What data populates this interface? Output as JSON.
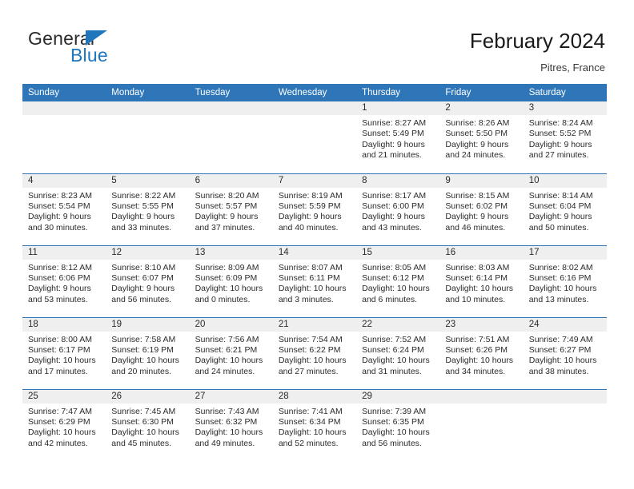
{
  "brand": {
    "name_part1": "General",
    "name_part2": "Blue",
    "triangle_icon": "triangle-icon",
    "accent_color": "#1F76BC"
  },
  "header": {
    "title": "February 2024",
    "location": "Pitres, France"
  },
  "calendar": {
    "header_color": "#2E76B8",
    "daynum_bg": "#EFEFEF",
    "weekday_headers": [
      "Sunday",
      "Monday",
      "Tuesday",
      "Wednesday",
      "Thursday",
      "Friday",
      "Saturday"
    ],
    "labels": {
      "sunrise": "Sunrise:",
      "sunset": "Sunset:",
      "daylight": "Daylight:"
    },
    "weeks": [
      [
        {
          "day": "",
          "lines": []
        },
        {
          "day": "",
          "lines": []
        },
        {
          "day": "",
          "lines": []
        },
        {
          "day": "",
          "lines": []
        },
        {
          "day": "1",
          "lines": [
            "Sunrise: 8:27 AM",
            "Sunset: 5:49 PM",
            "Daylight: 9 hours",
            "and 21 minutes."
          ]
        },
        {
          "day": "2",
          "lines": [
            "Sunrise: 8:26 AM",
            "Sunset: 5:50 PM",
            "Daylight: 9 hours",
            "and 24 minutes."
          ]
        },
        {
          "day": "3",
          "lines": [
            "Sunrise: 8:24 AM",
            "Sunset: 5:52 PM",
            "Daylight: 9 hours",
            "and 27 minutes."
          ]
        }
      ],
      [
        {
          "day": "4",
          "lines": [
            "Sunrise: 8:23 AM",
            "Sunset: 5:54 PM",
            "Daylight: 9 hours",
            "and 30 minutes."
          ]
        },
        {
          "day": "5",
          "lines": [
            "Sunrise: 8:22 AM",
            "Sunset: 5:55 PM",
            "Daylight: 9 hours",
            "and 33 minutes."
          ]
        },
        {
          "day": "6",
          "lines": [
            "Sunrise: 8:20 AM",
            "Sunset: 5:57 PM",
            "Daylight: 9 hours",
            "and 37 minutes."
          ]
        },
        {
          "day": "7",
          "lines": [
            "Sunrise: 8:19 AM",
            "Sunset: 5:59 PM",
            "Daylight: 9 hours",
            "and 40 minutes."
          ]
        },
        {
          "day": "8",
          "lines": [
            "Sunrise: 8:17 AM",
            "Sunset: 6:00 PM",
            "Daylight: 9 hours",
            "and 43 minutes."
          ]
        },
        {
          "day": "9",
          "lines": [
            "Sunrise: 8:15 AM",
            "Sunset: 6:02 PM",
            "Daylight: 9 hours",
            "and 46 minutes."
          ]
        },
        {
          "day": "10",
          "lines": [
            "Sunrise: 8:14 AM",
            "Sunset: 6:04 PM",
            "Daylight: 9 hours",
            "and 50 minutes."
          ]
        }
      ],
      [
        {
          "day": "11",
          "lines": [
            "Sunrise: 8:12 AM",
            "Sunset: 6:06 PM",
            "Daylight: 9 hours",
            "and 53 minutes."
          ]
        },
        {
          "day": "12",
          "lines": [
            "Sunrise: 8:10 AM",
            "Sunset: 6:07 PM",
            "Daylight: 9 hours",
            "and 56 minutes."
          ]
        },
        {
          "day": "13",
          "lines": [
            "Sunrise: 8:09 AM",
            "Sunset: 6:09 PM",
            "Daylight: 10 hours",
            "and 0 minutes."
          ]
        },
        {
          "day": "14",
          "lines": [
            "Sunrise: 8:07 AM",
            "Sunset: 6:11 PM",
            "Daylight: 10 hours",
            "and 3 minutes."
          ]
        },
        {
          "day": "15",
          "lines": [
            "Sunrise: 8:05 AM",
            "Sunset: 6:12 PM",
            "Daylight: 10 hours",
            "and 6 minutes."
          ]
        },
        {
          "day": "16",
          "lines": [
            "Sunrise: 8:03 AM",
            "Sunset: 6:14 PM",
            "Daylight: 10 hours",
            "and 10 minutes."
          ]
        },
        {
          "day": "17",
          "lines": [
            "Sunrise: 8:02 AM",
            "Sunset: 6:16 PM",
            "Daylight: 10 hours",
            "and 13 minutes."
          ]
        }
      ],
      [
        {
          "day": "18",
          "lines": [
            "Sunrise: 8:00 AM",
            "Sunset: 6:17 PM",
            "Daylight: 10 hours",
            "and 17 minutes."
          ]
        },
        {
          "day": "19",
          "lines": [
            "Sunrise: 7:58 AM",
            "Sunset: 6:19 PM",
            "Daylight: 10 hours",
            "and 20 minutes."
          ]
        },
        {
          "day": "20",
          "lines": [
            "Sunrise: 7:56 AM",
            "Sunset: 6:21 PM",
            "Daylight: 10 hours",
            "and 24 minutes."
          ]
        },
        {
          "day": "21",
          "lines": [
            "Sunrise: 7:54 AM",
            "Sunset: 6:22 PM",
            "Daylight: 10 hours",
            "and 27 minutes."
          ]
        },
        {
          "day": "22",
          "lines": [
            "Sunrise: 7:52 AM",
            "Sunset: 6:24 PM",
            "Daylight: 10 hours",
            "and 31 minutes."
          ]
        },
        {
          "day": "23",
          "lines": [
            "Sunrise: 7:51 AM",
            "Sunset: 6:26 PM",
            "Daylight: 10 hours",
            "and 34 minutes."
          ]
        },
        {
          "day": "24",
          "lines": [
            "Sunrise: 7:49 AM",
            "Sunset: 6:27 PM",
            "Daylight: 10 hours",
            "and 38 minutes."
          ]
        }
      ],
      [
        {
          "day": "25",
          "lines": [
            "Sunrise: 7:47 AM",
            "Sunset: 6:29 PM",
            "Daylight: 10 hours",
            "and 42 minutes."
          ]
        },
        {
          "day": "26",
          "lines": [
            "Sunrise: 7:45 AM",
            "Sunset: 6:30 PM",
            "Daylight: 10 hours",
            "and 45 minutes."
          ]
        },
        {
          "day": "27",
          "lines": [
            "Sunrise: 7:43 AM",
            "Sunset: 6:32 PM",
            "Daylight: 10 hours",
            "and 49 minutes."
          ]
        },
        {
          "day": "28",
          "lines": [
            "Sunrise: 7:41 AM",
            "Sunset: 6:34 PM",
            "Daylight: 10 hours",
            "and 52 minutes."
          ]
        },
        {
          "day": "29",
          "lines": [
            "Sunrise: 7:39 AM",
            "Sunset: 6:35 PM",
            "Daylight: 10 hours",
            "and 56 minutes."
          ]
        },
        {
          "day": "",
          "lines": []
        },
        {
          "day": "",
          "lines": []
        }
      ]
    ]
  }
}
